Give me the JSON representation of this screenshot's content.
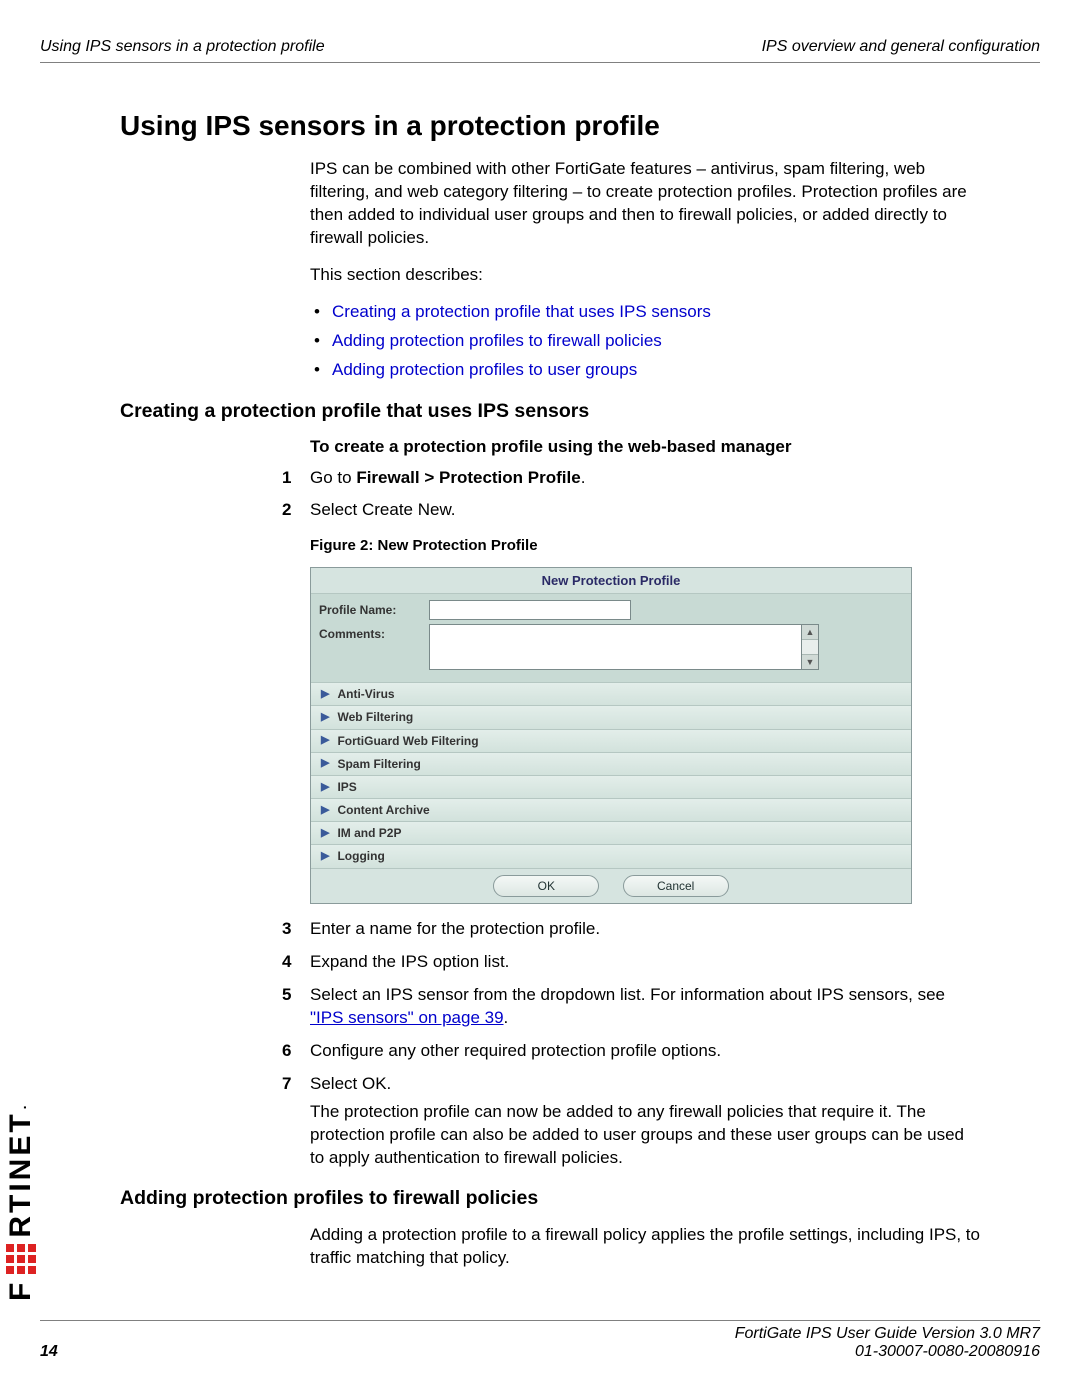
{
  "header": {
    "left": "Using IPS sensors in a protection profile",
    "right": "IPS overview and general configuration"
  },
  "h1": "Using IPS sensors in a protection profile",
  "intro1": "IPS can be combined with other FortiGate features – antivirus, spam filtering, web filtering, and web category filtering – to create protection profiles. Protection profiles are then added to individual user groups and then to firewall policies, or added directly to firewall policies.",
  "intro2": "This section describes:",
  "links": {
    "l1": "Creating a protection profile that uses IPS sensors",
    "l2": "Adding protection profiles to firewall policies",
    "l3": "Adding protection profiles to user groups"
  },
  "h2a": "Creating a protection profile that uses IPS sensors",
  "subhead_a": "To create a protection profile using the web-based manager",
  "steps_a": {
    "s1_pre": "Go to ",
    "s1_bold": "Firewall > Protection Profile",
    "s1_post": ".",
    "s2": "Select Create New.",
    "s3": "Enter a name for the protection profile.",
    "s4": "Expand the IPS option list.",
    "s5_pre": "Select an IPS sensor from the dropdown list. For information about IPS sensors, see ",
    "s5_xref": "\"IPS sensors\" on page 39",
    "s5_post": ".",
    "s6": "Configure any other required protection profile options.",
    "s7": "Select OK.",
    "after": "The protection profile can now be added to any firewall policies that require it. The protection profile can also be added to user groups and these user groups can be used to apply authentication to firewall policies."
  },
  "figcap": "Figure 2:   New Protection Profile",
  "npp": {
    "title": "New Protection Profile",
    "profile_label": "Profile Name:",
    "comments_label": "Comments:",
    "profile_value": "",
    "comments_value": "",
    "sections": [
      "Anti-Virus",
      "Web Filtering",
      "FortiGuard Web Filtering",
      "Spam Filtering",
      "IPS",
      "Content Archive",
      "IM and P2P",
      "Logging"
    ],
    "ok": "OK",
    "cancel": "Cancel"
  },
  "h2b": "Adding protection profiles to firewall policies",
  "para_b": "Adding a protection profile to a firewall policy applies the profile settings, including IPS, to traffic matching that policy.",
  "footer": {
    "line1": "FortiGate IPS User Guide Version 3.0 MR7",
    "line2": "01-30007-0080-20080916",
    "page": "14"
  },
  "logo": {
    "part1": "F",
    "part2": "RTINET"
  }
}
